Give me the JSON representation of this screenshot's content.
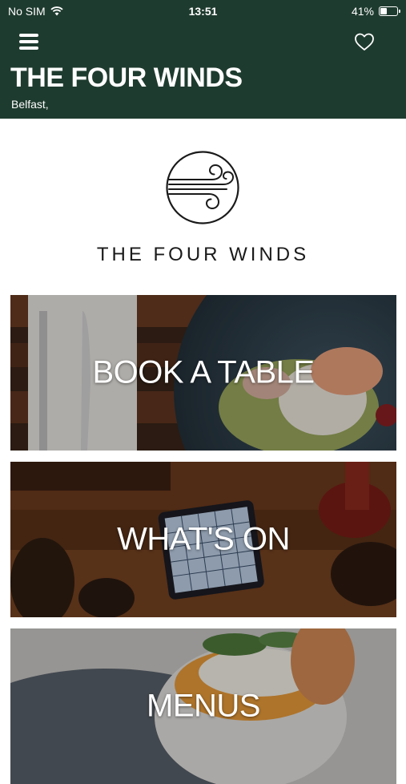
{
  "status_bar": {
    "carrier": "No SIM",
    "time": "13:51",
    "battery_percent": "41%",
    "battery_level": 0.41
  },
  "header": {
    "title": "THE FOUR WINDS",
    "subtitle": "Belfast,",
    "menu_icon": "hamburger-menu-icon",
    "favorite_icon": "heart-outline-icon",
    "background_color": "#1e3b2f"
  },
  "logo": {
    "icon": "wind-logo-icon",
    "text": "THE FOUR WINDS"
  },
  "tiles": [
    {
      "label": "BOOK A TABLE"
    },
    {
      "label": "WHAT'S ON"
    },
    {
      "label": "MENUS"
    }
  ]
}
